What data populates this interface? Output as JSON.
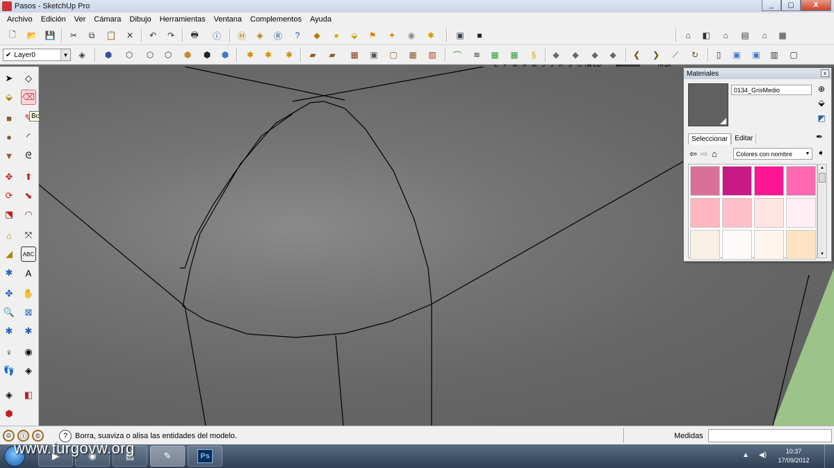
{
  "window": {
    "title": "Pasos - SketchUp Pro",
    "controls": [
      "_",
      "▢",
      "X"
    ]
  },
  "menu": [
    "Archivo",
    "Edición",
    "Ver",
    "Cámara",
    "Dibujo",
    "Herramientas",
    "Ventana",
    "Complementos",
    "Ayuda"
  ],
  "toolbar": {
    "layer": "Layer0",
    "shadow_months": "E F M A M J J A S O N D",
    "time_start": "06:43",
    "time_mid": "Mediodía",
    "time_end": "16:46"
  },
  "tooltip": "Borrar",
  "materials": {
    "title": "Materiales",
    "current_material": "0134_GrisMedio",
    "current_color": "#606060",
    "tab_select": "Seleccionar",
    "tab_edit": "Editar",
    "library": "Colores con nombre",
    "swatches": [
      "#d9709a",
      "#c71a86",
      "#ff1493",
      "#ff69b4",
      "#ffb6c1",
      "#ffc0cb",
      "#ffe4e1",
      "#fff0f5",
      "#faf0e6",
      "#fffafa",
      "#fff5ee",
      "#ffe4c4"
    ]
  },
  "status": {
    "message": "Borra, suaviza o alisa las entidades del modelo.",
    "measure_label": "Medidas",
    "measure_value": ""
  },
  "taskbar": {
    "watermark": "www.furgovw.org",
    "time": "10:37",
    "date": "17/09/2012"
  }
}
